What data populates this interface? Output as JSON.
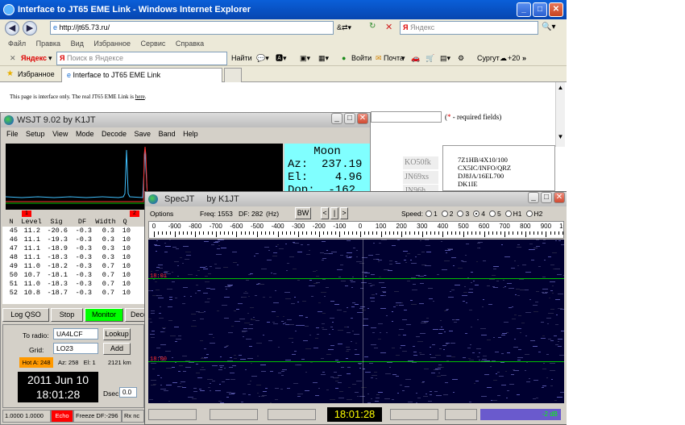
{
  "ie": {
    "title": "Interface to JT65 EME Link - Windows Internet Explorer",
    "url": "http://jt65.73.ru/",
    "search_placeholder": "Яндекс",
    "menu": [
      "Файл",
      "Правка",
      "Вид",
      "Избранное",
      "Сервис",
      "Справка"
    ],
    "toolbar": {
      "yandex": "Яндекс",
      "search_placeholder": "Поиск в Яндексе",
      "find": "Найти",
      "login": "Войти",
      "mail": "Почта",
      "city": "Сургут",
      "temp": "+20"
    },
    "favorites": "Избранное",
    "tab_label": "Interface to JT65 EME Link",
    "page_text_1": "This page is interface only. The real JT65 EME Link is ",
    "page_link": "here",
    "page_text_2": ".",
    "required_star": "*",
    "required_text": " - required fields)",
    "required_open": "(",
    "locators": [
      "KO50fk",
      "JN69xs",
      "JN96h"
    ],
    "callsigns": [
      "7Z1HB/4X10/100",
      "CX5IC/INFO/QRZ",
      "DJ8JA/16EL700",
      "DK1IE"
    ]
  },
  "wsjt": {
    "title": "WSJT 9.02    by K1JT",
    "menu": [
      "File",
      "Setup",
      "View",
      "Mode",
      "Decode",
      "Save",
      "Band",
      "Help"
    ],
    "moon": {
      "heading": "Moon",
      "az": "Az:  237.19",
      "el": "El:    4.96",
      "dop": "Dop:  -162"
    },
    "markers": [
      "1",
      "2"
    ],
    "table_headers": [
      "N",
      "Level",
      "Sig",
      "DF",
      "Width",
      "Q"
    ],
    "rows": [
      [
        "45",
        "11.2",
        "-20.6",
        "-0.3",
        "0.3",
        "10"
      ],
      [
        "46",
        "11.1",
        "-19.3",
        "-0.3",
        "0.3",
        "10"
      ],
      [
        "47",
        "11.1",
        "-18.9",
        "-0.3",
        "0.3",
        "10"
      ],
      [
        "48",
        "11.1",
        "-18.3",
        "-0.3",
        "0.3",
        "10"
      ],
      [
        "49",
        "11.0",
        "-18.2",
        "-0.3",
        "0.7",
        "10"
      ],
      [
        "50",
        "10.7",
        "-18.1",
        "-0.3",
        "0.7",
        "10"
      ],
      [
        "51",
        "11.0",
        "-18.3",
        "-0.3",
        "0.7",
        "10"
      ],
      [
        "52",
        "10.8",
        "-18.7",
        "-0.3",
        "0.7",
        "10"
      ]
    ],
    "buttons": {
      "log_qso": "Log QSO",
      "stop": "Stop",
      "monitor": "Monitor",
      "decode": "Deco"
    },
    "to_radio_label": "To radio:",
    "to_radio_value": "UA4LCF",
    "lookup": "Lookup",
    "grid_label": "Grid:",
    "grid_value": "LO23",
    "add": "Add",
    "hot_a": "Hot A: 248",
    "az_el": "Az: 258   El: 1",
    "distance": "2121 km",
    "date": "2011 Jun 10",
    "time": "18:01:28",
    "dsec_label": "Dsec",
    "dsec_value": "0.0",
    "status": [
      "1.0000 1.0000",
      "Echo",
      "Freeze DF:-296",
      "Rx nc"
    ]
  },
  "spec": {
    "title": "SpecJT     by K1JT",
    "options": "Options",
    "freq_label": "Freq:",
    "freq_value": "1553",
    "df_label": "DF:",
    "df_value": "282",
    "df_unit": "(Hz)",
    "bw": "BW",
    "nav": [
      "<",
      "|",
      ">"
    ],
    "speed_label": "Speed:",
    "speeds": [
      "1",
      "2",
      "3",
      "4",
      "5",
      "H1",
      "H2"
    ],
    "speed_selected": "4",
    "axis_ticks": [
      "0",
      "-900",
      "-800",
      "-700",
      "-600",
      "-500",
      "-400",
      "-300",
      "-200",
      "-100",
      "0",
      "100",
      "200",
      "300",
      "400",
      "500",
      "600",
      "700",
      "800",
      "900",
      "1000"
    ],
    "time_marks": [
      "18:01",
      "18:00"
    ],
    "clock": "18:01:28",
    "db": "-2 dB"
  },
  "colors": {
    "ie_title": "#0a5fd8",
    "moon_bg": "#80ffff",
    "waterfall_bg": "#000030",
    "hot_a": "#ff9900",
    "monitor": "#00ff00",
    "echo": "#ff0000",
    "clock_bg": "#000000",
    "clock_fg": "#ffff00"
  }
}
